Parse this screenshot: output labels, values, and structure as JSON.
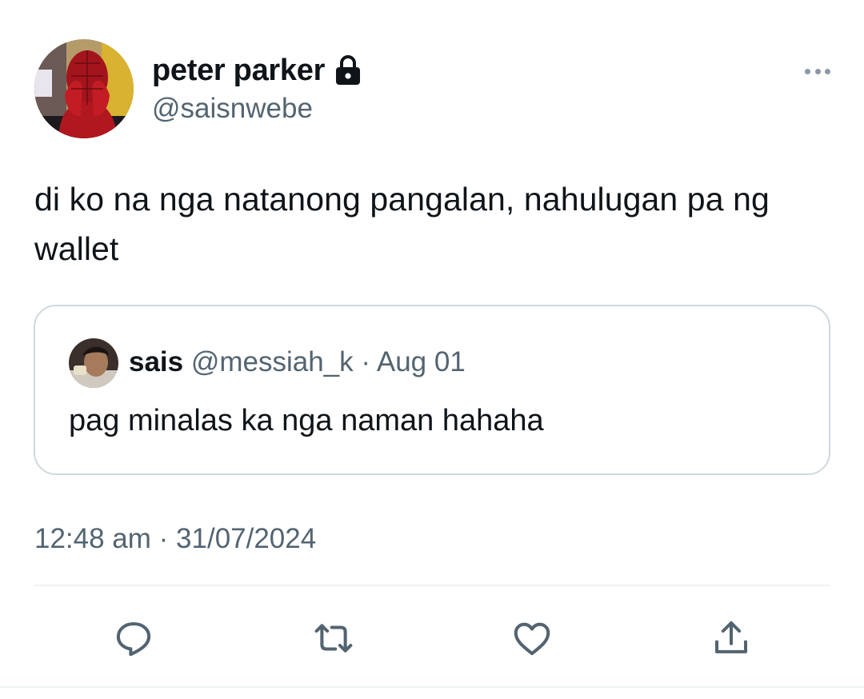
{
  "author": {
    "display_name": "peter parker",
    "handle": "@saisnwebe",
    "protected": true,
    "avatar_icon": "spiderman-photo-avatar"
  },
  "tweet": {
    "text": "di ko na nga natanong pangalan, nahulugan pa ng wallet",
    "timestamp": "12:48 am · 31/07/2024"
  },
  "quote": {
    "display_name": "sais",
    "handle": "@messiah_k",
    "separator": "·",
    "date": "Aug 01",
    "text": "pag minalas ka nga naman hahaha"
  },
  "actions": [
    "reply-icon",
    "retweet-icon",
    "like-icon",
    "share-icon"
  ],
  "colors": {
    "text_primary": "#0f1419",
    "text_secondary": "#536471",
    "border": "#cfd9de",
    "divider": "#eff3f4"
  }
}
